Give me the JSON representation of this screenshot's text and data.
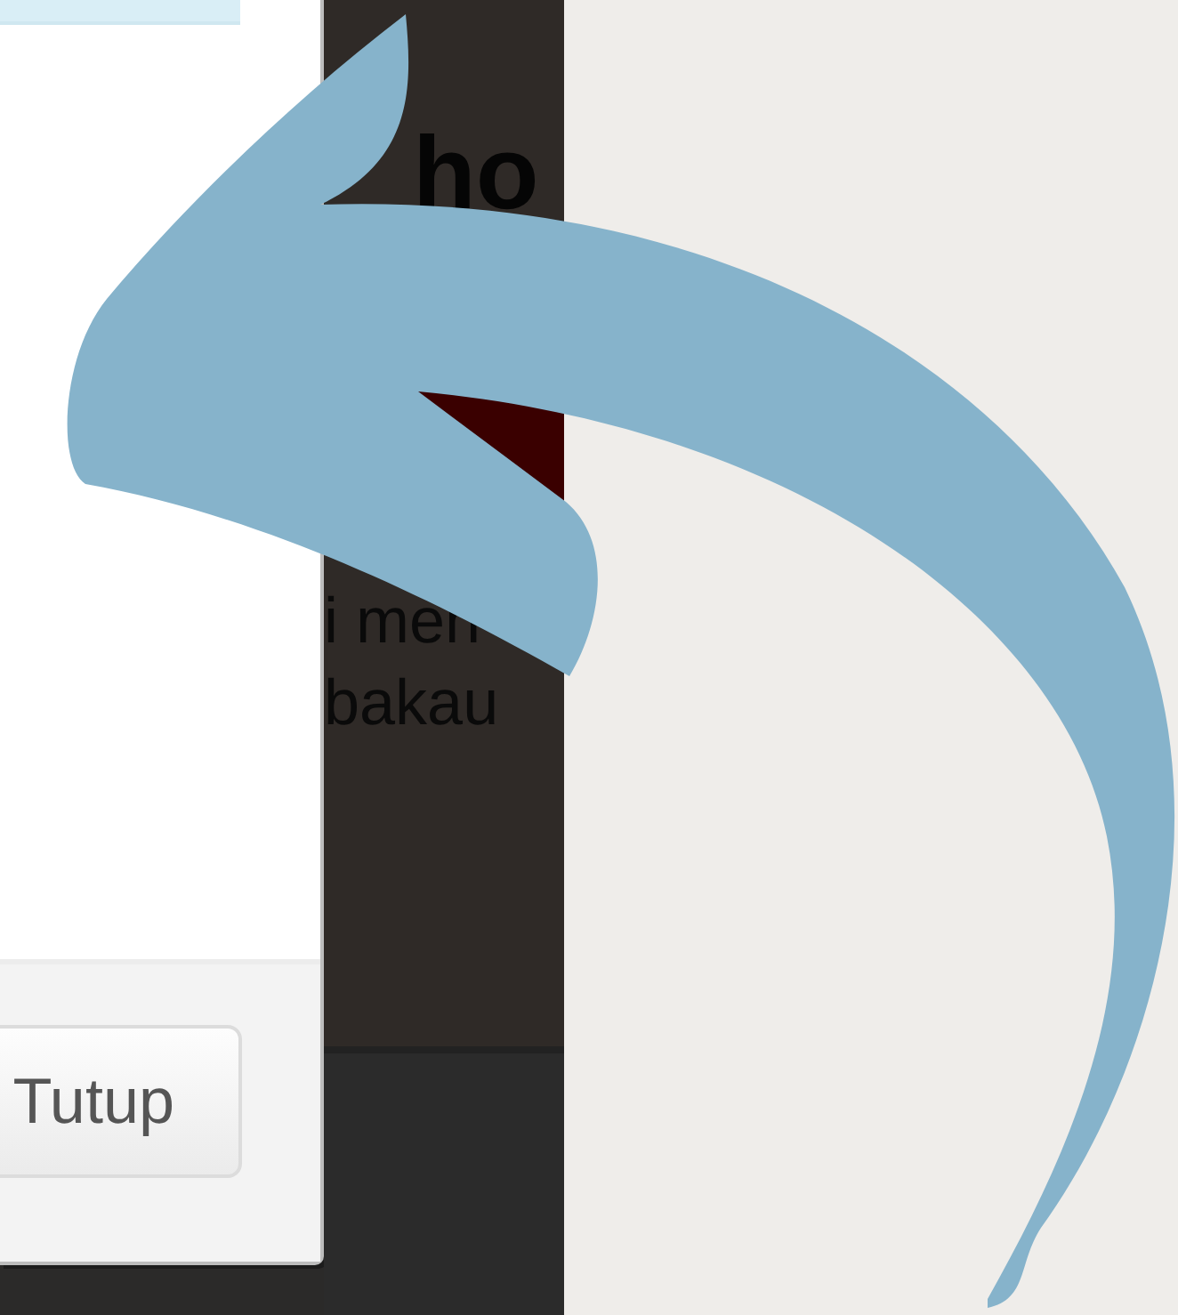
{
  "dialog": {
    "buttons": [
      "Tutup"
    ]
  },
  "page": {
    "heading": "ho",
    "lines": [
      "i men",
      "bakau"
    ]
  }
}
